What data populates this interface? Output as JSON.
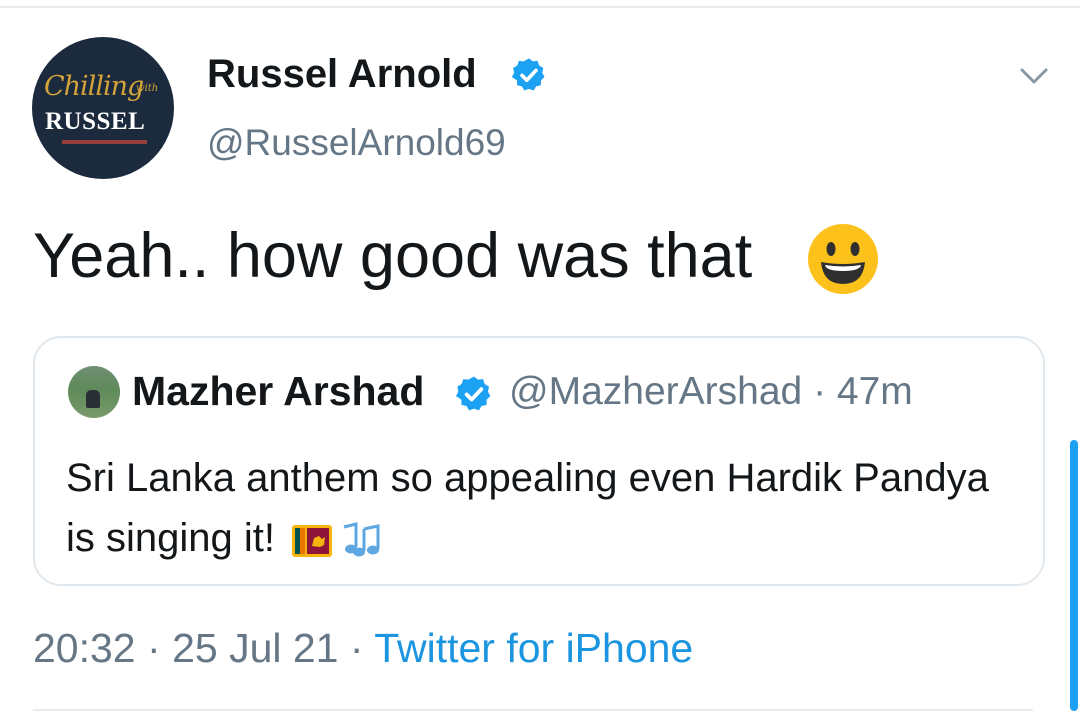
{
  "tweet": {
    "author": {
      "name": "Russel Arnold",
      "handle": "@RusselArnold69",
      "avatar_text": {
        "script": "Chilling",
        "with": "with",
        "brand": "RUSSEL"
      }
    },
    "text": "Yeah.. how good was that",
    "emoji": "smiley-face",
    "quoted": {
      "name": "Mazher Arshad",
      "handle": "@MazherArshad",
      "separator": "·",
      "age": "47m",
      "text": "Sri Lanka anthem so appealing even Hardik Pandya is singing it!",
      "emojis": [
        "sri-lanka-flag",
        "musical-notes"
      ]
    },
    "meta": {
      "time": "20:32",
      "sep1": "·",
      "date": "25 Jul 21",
      "sep2": "·",
      "source": "Twitter for iPhone"
    }
  },
  "colors": {
    "text": "#14171a",
    "secondary": "#657786",
    "link": "#1b95e0",
    "verified": "#1da1f2",
    "border": "#e1e8ed"
  }
}
